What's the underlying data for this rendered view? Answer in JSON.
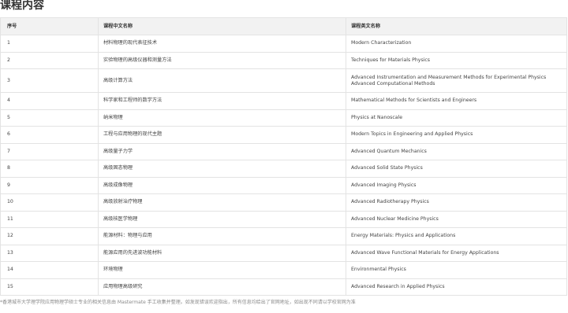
{
  "title": "课程内容",
  "table": {
    "headers": [
      "序号",
      "课程中文名称",
      "课程英文名称"
    ],
    "rows": [
      {
        "no": "1",
        "cn": "材料物理的现代表征技术",
        "en": "Modern Characterization"
      },
      {
        "no": "2",
        "cn": "实验物理的高级仪器和测量方法",
        "en": "Techniques for Materials Physics"
      },
      {
        "no": "3",
        "cn": "高级计算方法",
        "en": "Advanced Instrumentation and Measurement Methods for Experimental Physics Advanced Computational Methods"
      },
      {
        "no": "4",
        "cn": "科学家和工程师的数学方法",
        "en": "Mathematical Methods for Scientists and Engineers"
      },
      {
        "no": "5",
        "cn": "纳米物理",
        "en": "Physics at Nanoscale"
      },
      {
        "no": "6",
        "cn": "工程与应用物理的现代主题",
        "en": "Modern Topics in Engineering and Applied Physics"
      },
      {
        "no": "7",
        "cn": "高级量子力学",
        "en": "Advanced Quantum Mechanics"
      },
      {
        "no": "8",
        "cn": "高级固态物理",
        "en": "Advanced Solid State Physics"
      },
      {
        "no": "9",
        "cn": "高级成像物理",
        "en": "Advanced Imaging Physics"
      },
      {
        "no": "10",
        "cn": "高级放射治疗物理",
        "en": "Advanced Radiotherapy Physics"
      },
      {
        "no": "11",
        "cn": "高级核医学物理",
        "en": "Advanced Nuclear Medicine Physics"
      },
      {
        "no": "12",
        "cn": "能源材料：物理与应用",
        "en": "Energy Materials: Physics and Applications"
      },
      {
        "no": "13",
        "cn": "能源应用的先进波功能材料",
        "en": "Advanced Wave Functional Materials for Energy Applications"
      },
      {
        "no": "14",
        "cn": "环境物理",
        "en": "Environmental Physics"
      },
      {
        "no": "15",
        "cn": "应用物理高级研究",
        "en": "Advanced Research in Applied Physics"
      }
    ]
  },
  "footnote": "*香港城市大学理学院应用物理学硕士专业的相关信息由 Mastermate 手工收集并整理。如发现错误欢迎指出，所有信息均给出了官网地址，如出现不同请以学校官网为准"
}
